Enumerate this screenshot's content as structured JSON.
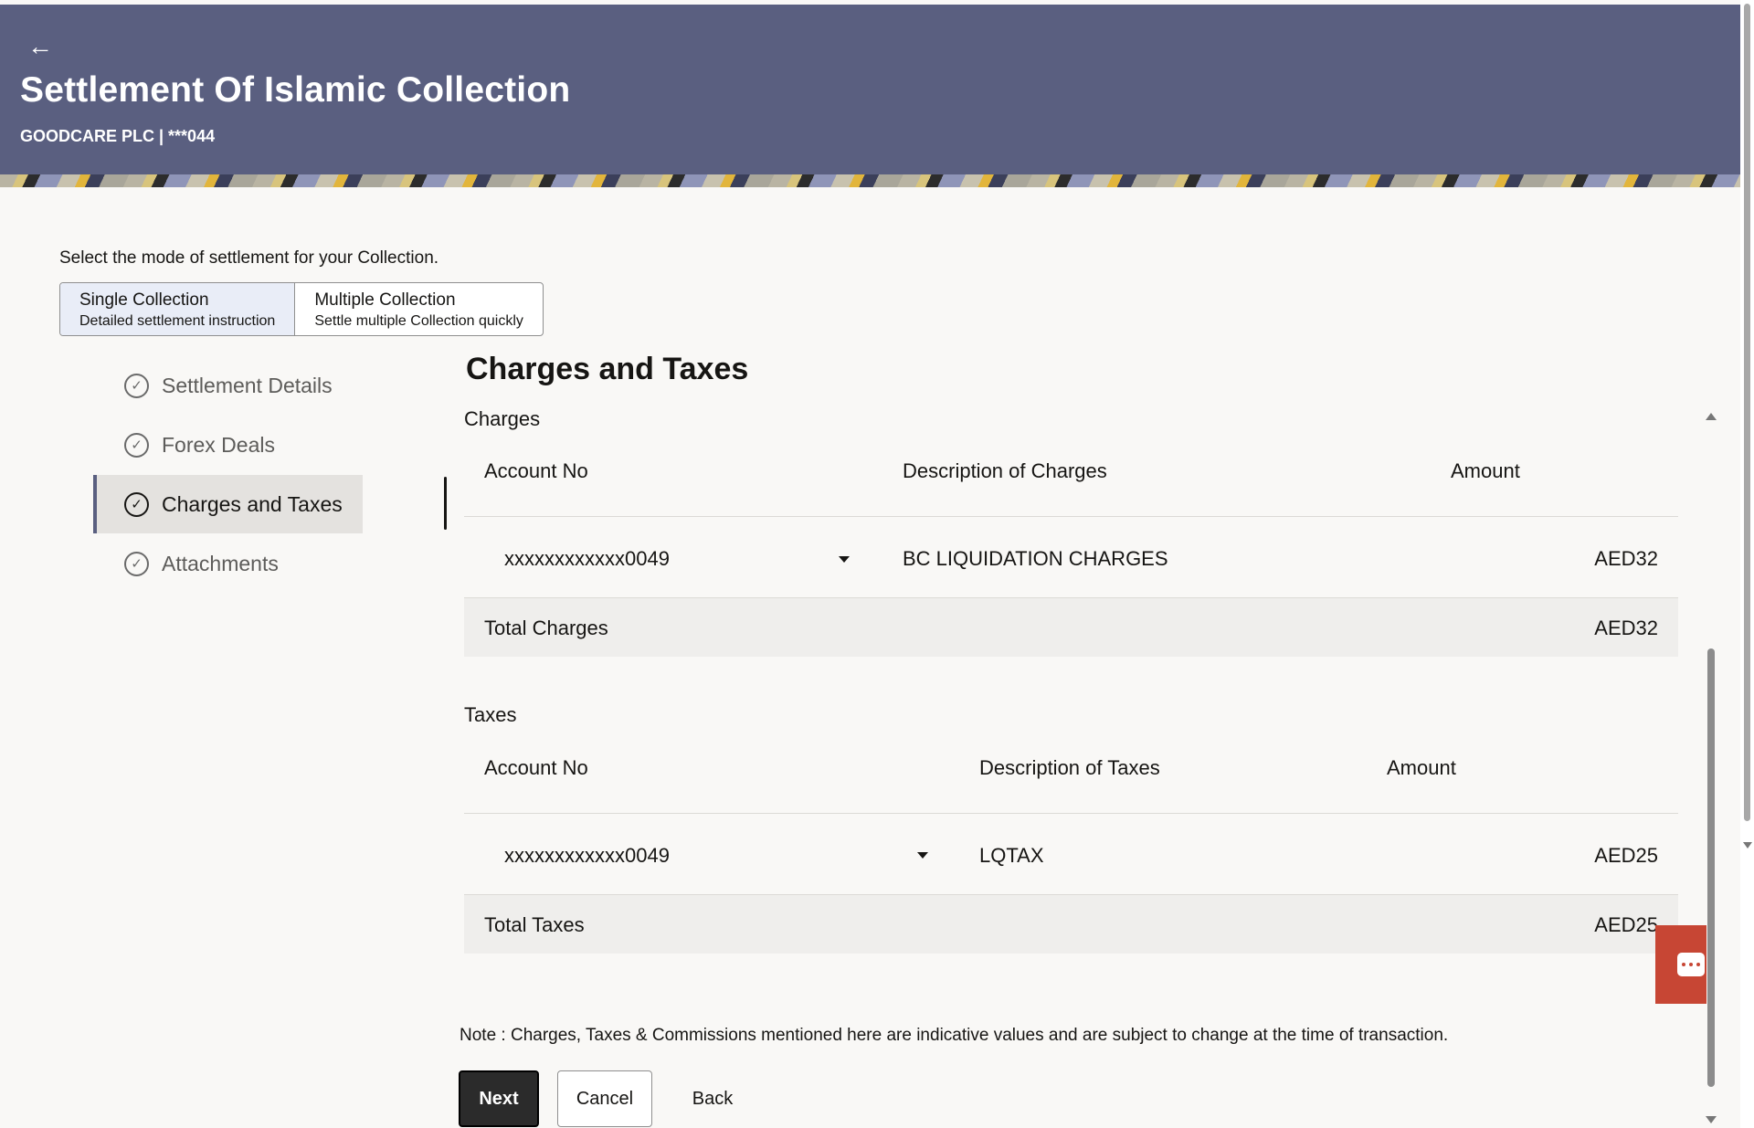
{
  "header": {
    "back_icon": "arrow-left-icon",
    "title": "Settlement Of Islamic Collection",
    "subtitle": "GOODCARE PLC | ***044"
  },
  "intro_text": "Select the mode of settlement for your Collection.",
  "settlement_modes": [
    {
      "title": "Single Collection",
      "description": "Detailed settlement instruction",
      "selected": true
    },
    {
      "title": "Multiple Collection",
      "description": "Settle multiple Collection quickly",
      "selected": false
    }
  ],
  "steps": [
    {
      "label": "Settlement Details",
      "icon": "check-circle-icon",
      "active": false
    },
    {
      "label": "Forex Deals",
      "icon": "check-circle-icon",
      "active": false
    },
    {
      "label": "Charges and Taxes",
      "icon": "check-circle-icon",
      "active": true
    },
    {
      "label": "Attachments",
      "icon": "check-circle-icon",
      "active": false
    }
  ],
  "section_title": "Charges and Taxes",
  "charges": {
    "label": "Charges",
    "columns": [
      "Account No",
      "Description of Charges",
      "Amount"
    ],
    "rows": [
      {
        "account": "xxxxxxxxxxxx0049",
        "description": "BC LIQUIDATION CHARGES",
        "amount": "AED32"
      }
    ],
    "total_label": "Total Charges",
    "total_value": "AED32"
  },
  "taxes": {
    "label": "Taxes",
    "columns": [
      "Account No",
      "Description of Taxes",
      "Amount"
    ],
    "rows": [
      {
        "account": "xxxxxxxxxxxx0049",
        "description": "LQTAX",
        "amount": "AED25"
      }
    ],
    "total_label": "Total Taxes",
    "total_value": "AED25"
  },
  "note": "Note : Charges, Taxes & Commissions mentioned here are indicative values and are subject to change at the time of transaction.",
  "buttons": {
    "next": "Next",
    "cancel": "Cancel",
    "back": "Back"
  },
  "colors": {
    "header_bg": "#5a5f80",
    "primary_button": "#2b2b2b",
    "chat_button": "#c74634",
    "active_step_bg": "#e4e2df"
  }
}
